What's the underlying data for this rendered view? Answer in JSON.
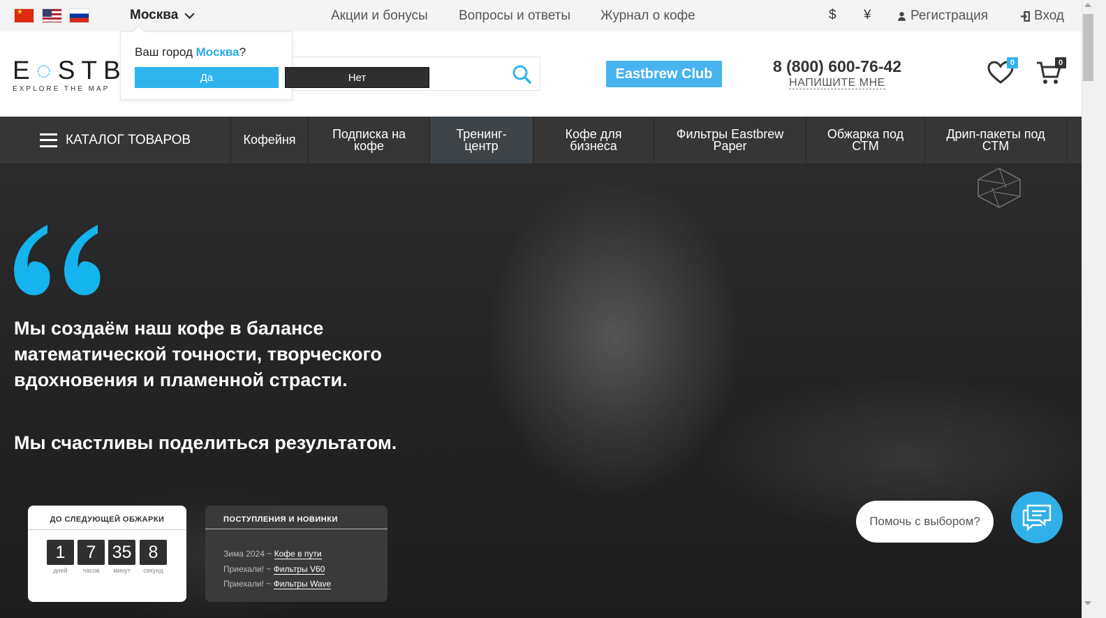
{
  "topbar": {
    "flags": [
      {
        "name": "china-flag-icon"
      },
      {
        "name": "usa-flag-icon"
      },
      {
        "name": "russia-flag-icon"
      }
    ],
    "city": "Москва",
    "links": [
      "Акции и бонусы",
      "Вопросы и ответы",
      "Журнал о кофе"
    ],
    "currencies": [
      "$",
      "¥"
    ],
    "register": "Регистрация",
    "login": "Вход"
  },
  "city_popup": {
    "question_prefix": "Ваш город",
    "city": "Москва",
    "question_suffix": "?",
    "yes": "Да",
    "no": "Нет"
  },
  "header": {
    "logo_text": "EASTBREW",
    "logo_visible": "E◌STB",
    "logo_sub": "EXPLORE THE MAP",
    "logo_sub_visible": "EXPLORE THE MAP",
    "search_placeholder": "",
    "club_button": "Eastbrew Club",
    "phone": "8 (800) 600-76-42",
    "write_me": "НАПИШИТЕ МНЕ",
    "favorites_count": "0",
    "cart_count": "0",
    "accent_color": "#2fb4ee"
  },
  "nav": {
    "catalog": "КАТАЛОГ ТОВАРОВ",
    "items": [
      "Кофейня",
      "Подписка на кофе",
      "Тренинг-центр",
      "Кофе для бизнеса",
      "Фильтры Eastbrew Paper",
      "Обжарка под СТМ",
      "Дрип-пакеты под СТМ"
    ]
  },
  "hero": {
    "quote_line": "Мы создаём наш кофе в балансе математической точности, творческого вдохновения и пламенной страсти.",
    "quote_line2": "Мы счастливы поделиться результатом.",
    "roast": {
      "title": "ДО СЛЕДУЮЩЕЙ ОБЖАРКИ",
      "days": "1",
      "hours": "7",
      "minutes": "35",
      "seconds": "8",
      "days_label": "дней",
      "hours_label": "часов",
      "minutes_label": "минут",
      "seconds_label": "секунд"
    },
    "news": {
      "title": "ПОСТУПЛЕНИЯ И НОВИНКИ",
      "rows": [
        {
          "prefix": "Зима 2024 ~ ",
          "link": "Кофе в пути"
        },
        {
          "prefix": "Приехали! ~ ",
          "link": "Фильтры V60"
        },
        {
          "prefix": "Приехали! ~ ",
          "link": "Фильтры Wave"
        }
      ]
    },
    "help_bubble": "Помочь с выбором?"
  }
}
